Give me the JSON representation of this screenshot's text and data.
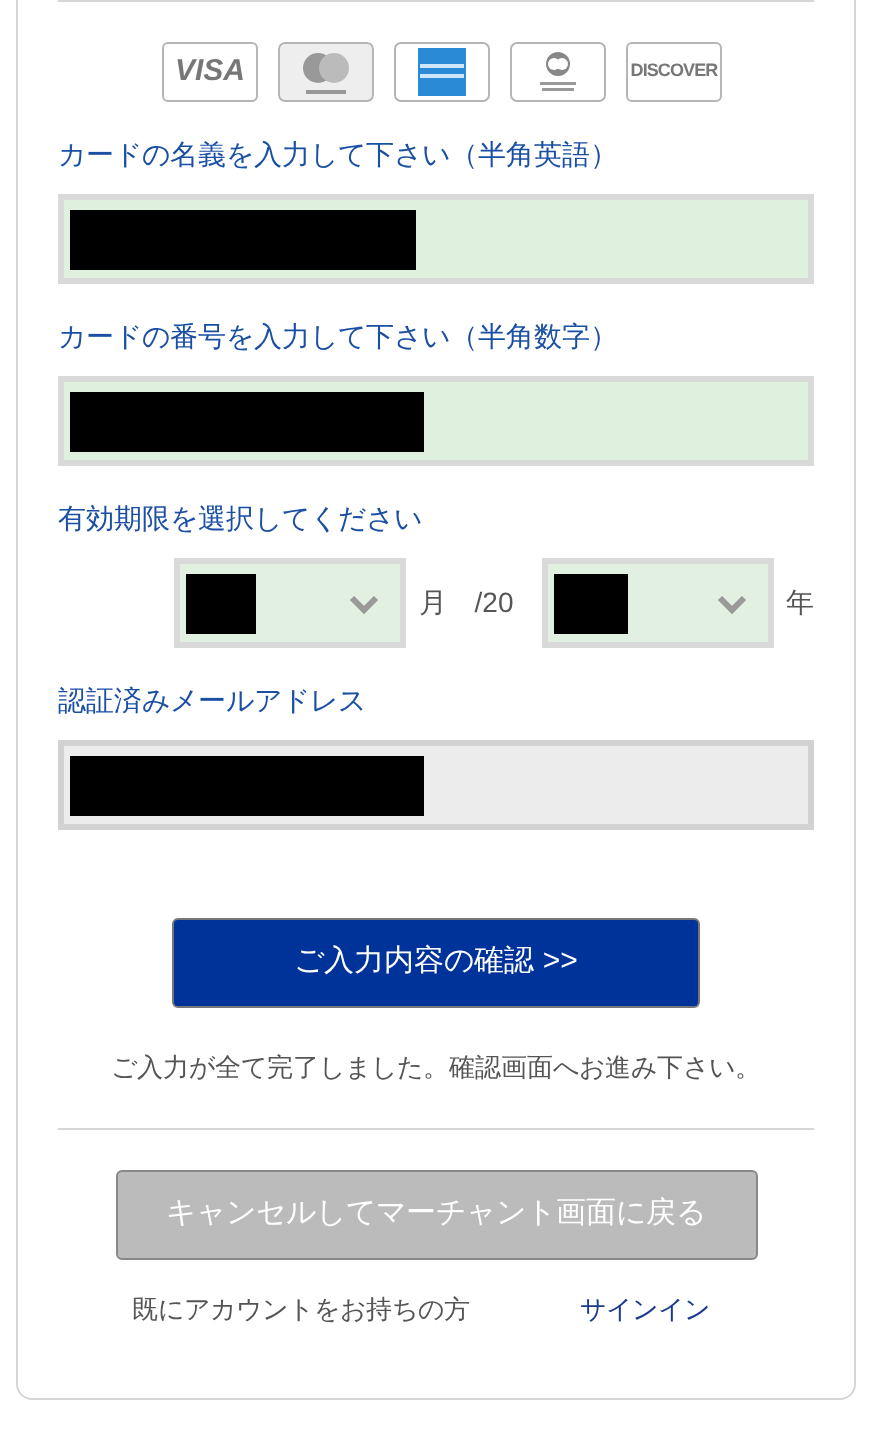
{
  "card_brands": [
    {
      "kind": "visa",
      "label": "VISA"
    },
    {
      "kind": "mastercard"
    },
    {
      "kind": "amex"
    },
    {
      "kind": "diners"
    },
    {
      "kind": "discover",
      "label": "DISCOVER"
    }
  ],
  "fields": [
    {
      "kind": "text",
      "label": "カードの名義を入力して下さい（半角英語）",
      "redacted": true
    },
    {
      "kind": "text",
      "label": "カードの番号を入力して下さい（半角数字）",
      "redacted": true
    },
    {
      "kind": "expiry",
      "label": "有効期限を選択してください",
      "month_unit": "月",
      "year_prefix": "/20",
      "year_unit": "年",
      "redacted": true
    },
    {
      "kind": "readonly",
      "label": "認証済みメールアドレス",
      "redacted": true
    }
  ],
  "confirm_button": "ご入力内容の確認 >>",
  "message": "ご入力が全て完了しました。確認画面へお進み下さい。",
  "cancel_button": "キャンセルしてマーチャント画面に戻る",
  "account_prompt": "既にアカウントをお持ちの方",
  "signin_link": "サインイン"
}
